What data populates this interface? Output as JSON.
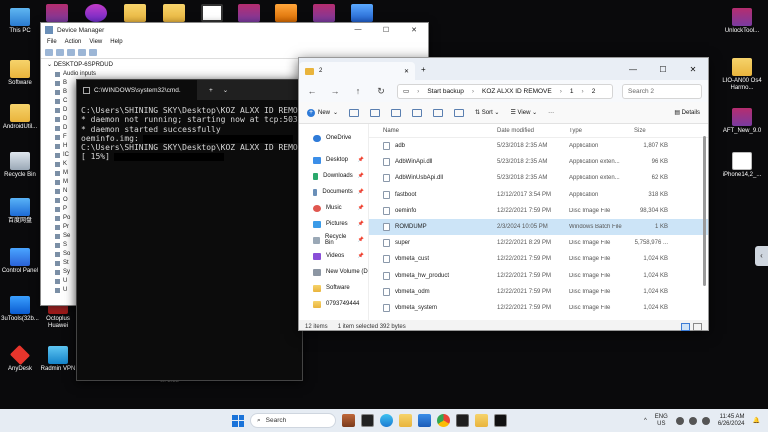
{
  "desktop_left": [
    {
      "label": "This PC",
      "icon": "this-pc-icon"
    },
    {
      "label": "Software",
      "icon": "folder-icon"
    },
    {
      "label": "AndroidUtil...",
      "icon": "folder-icon"
    },
    {
      "label": "Recycle Bin",
      "icon": "recycle-bin-icon"
    },
    {
      "label": "百度网盘",
      "icon": "baidu-netdisk-icon"
    },
    {
      "label": "Control Panel",
      "icon": "control-panel-icon"
    },
    {
      "label": "3uTools(32b...",
      "icon": "3utools-icon"
    },
    {
      "label": "Octoplus Huawei",
      "icon": "octoplus-icon"
    },
    {
      "label": "AnyDesk",
      "icon": "anydesk-icon"
    },
    {
      "label": "Radmin VPN",
      "icon": "radmin-vpn-icon"
    }
  ],
  "desktop_right": [
    {
      "label": "UnlockTool...",
      "icon": "winrar-icon"
    },
    {
      "label": "LIO-AN00 Os4 Harmo...",
      "icon": "folder-icon"
    },
    {
      "label": "AFT_New_9.0",
      "icon": "winrar-icon"
    },
    {
      "label": "iPhone14,2_...",
      "icon": "document-icon"
    }
  ],
  "device_manager": {
    "title": "Device Manager",
    "menu": [
      "File",
      "Action",
      "View",
      "Help"
    ],
    "root": "DESKTOP-6SPRDUD",
    "nodes": [
      "Audio inputs",
      "B",
      "B",
      "C",
      "D",
      "D",
      "D",
      "F",
      "H",
      "IC",
      "K",
      "M",
      "M",
      "N",
      "O",
      "P",
      "Po",
      "Pr",
      "Se",
      "S",
      "So",
      "St",
      "Sy",
      "U",
      "U"
    ]
  },
  "cmd": {
    "tab_title": "C:\\WINDOWS\\system32\\cmd.",
    "lines": [
      "C:\\Users\\SHINING SKY\\Desktop\\KOZ ALXX ID REMO",
      "* daemon not running; starting now at tcp:503",
      "* daemon started successfully",
      "oeminfo.img:",
      "",
      "C:\\Users\\SHINING SKY\\Desktop\\KOZ ALXX ID REMO",
      "[ 15%]"
    ]
  },
  "explorer": {
    "tab_title": "2",
    "path": [
      "Start backup",
      "KOZ ALXX ID REMOVE",
      "1",
      "2"
    ],
    "search_placeholder": "Search 2",
    "cmdbar": {
      "new": "New",
      "sort": "Sort",
      "view": "View",
      "details": "Details"
    },
    "nav": [
      {
        "label": "OneDrive",
        "icon": "onedrive-icon",
        "pinned": false
      },
      {
        "label": "Desktop",
        "icon": "desktop-icon",
        "pinned": true
      },
      {
        "label": "Downloads",
        "icon": "downloads-icon",
        "pinned": true
      },
      {
        "label": "Documents",
        "icon": "documents-icon",
        "pinned": true
      },
      {
        "label": "Music",
        "icon": "music-icon",
        "pinned": true
      },
      {
        "label": "Pictures",
        "icon": "pictures-icon",
        "pinned": true
      },
      {
        "label": "Recycle Bin",
        "icon": "recycle-bin-icon",
        "pinned": true
      },
      {
        "label": "Videos",
        "icon": "videos-icon",
        "pinned": true
      },
      {
        "label": "New Volume (D",
        "icon": "drive-icon",
        "pinned": true
      },
      {
        "label": "Software",
        "icon": "folder-icon",
        "pinned": false
      },
      {
        "label": "0793749444",
        "icon": "folder-icon",
        "pinned": false
      }
    ],
    "columns": [
      "Name",
      "Date modified",
      "Type",
      "Size"
    ],
    "files": [
      {
        "name": "adb",
        "date": "5/23/2018 2:35 AM",
        "type": "Application",
        "size": "1,807 KB"
      },
      {
        "name": "AdbWinApi.dll",
        "date": "5/23/2018 2:35 AM",
        "type": "Application exten...",
        "size": "96 KB"
      },
      {
        "name": "AdbWinUsbApi.dll",
        "date": "5/23/2018 2:35 AM",
        "type": "Application exten...",
        "size": "62 KB"
      },
      {
        "name": "fastboot",
        "date": "12/12/2017 3:54 PM",
        "type": "Application",
        "size": "318 KB"
      },
      {
        "name": "oeminfo",
        "date": "12/22/2021 7:59 PM",
        "type": "Disc Image File",
        "size": "98,304 KB"
      },
      {
        "name": "ROMDUMP",
        "date": "2/3/2024 10:05 PM",
        "type": "Windows Batch File",
        "size": "1 KB"
      },
      {
        "name": "super",
        "date": "12/22/2021 8:29 PM",
        "type": "Disc Image File",
        "size": "5,758,976 ..."
      },
      {
        "name": "vbmeta_cust",
        "date": "12/22/2021 7:59 PM",
        "type": "Disc Image File",
        "size": "1,024 KB"
      },
      {
        "name": "vbmeta_hw_product",
        "date": "12/22/2021 7:59 PM",
        "type": "Disc Image File",
        "size": "1,024 KB"
      },
      {
        "name": "vbmeta_odm",
        "date": "12/22/2021 7:59 PM",
        "type": "Disc Image File",
        "size": "1,024 KB"
      },
      {
        "name": "vbmeta_system",
        "date": "12/22/2021 7:59 PM",
        "type": "Disc Image File",
        "size": "1,024 KB"
      }
    ],
    "selected_index": 5,
    "status_items": "12 items",
    "status_selected": "1 item selected  392 bytes"
  },
  "taskbar": {
    "search": "Search",
    "lang1": "ENG",
    "lang2": "US",
    "time": "11:45 AM",
    "date": "6/26/2024"
  },
  "bg_text": "wi 3.33",
  "colors": {
    "accent": "#1a73d9",
    "selection": "#cce4f7",
    "folder": "#e9b43c"
  }
}
